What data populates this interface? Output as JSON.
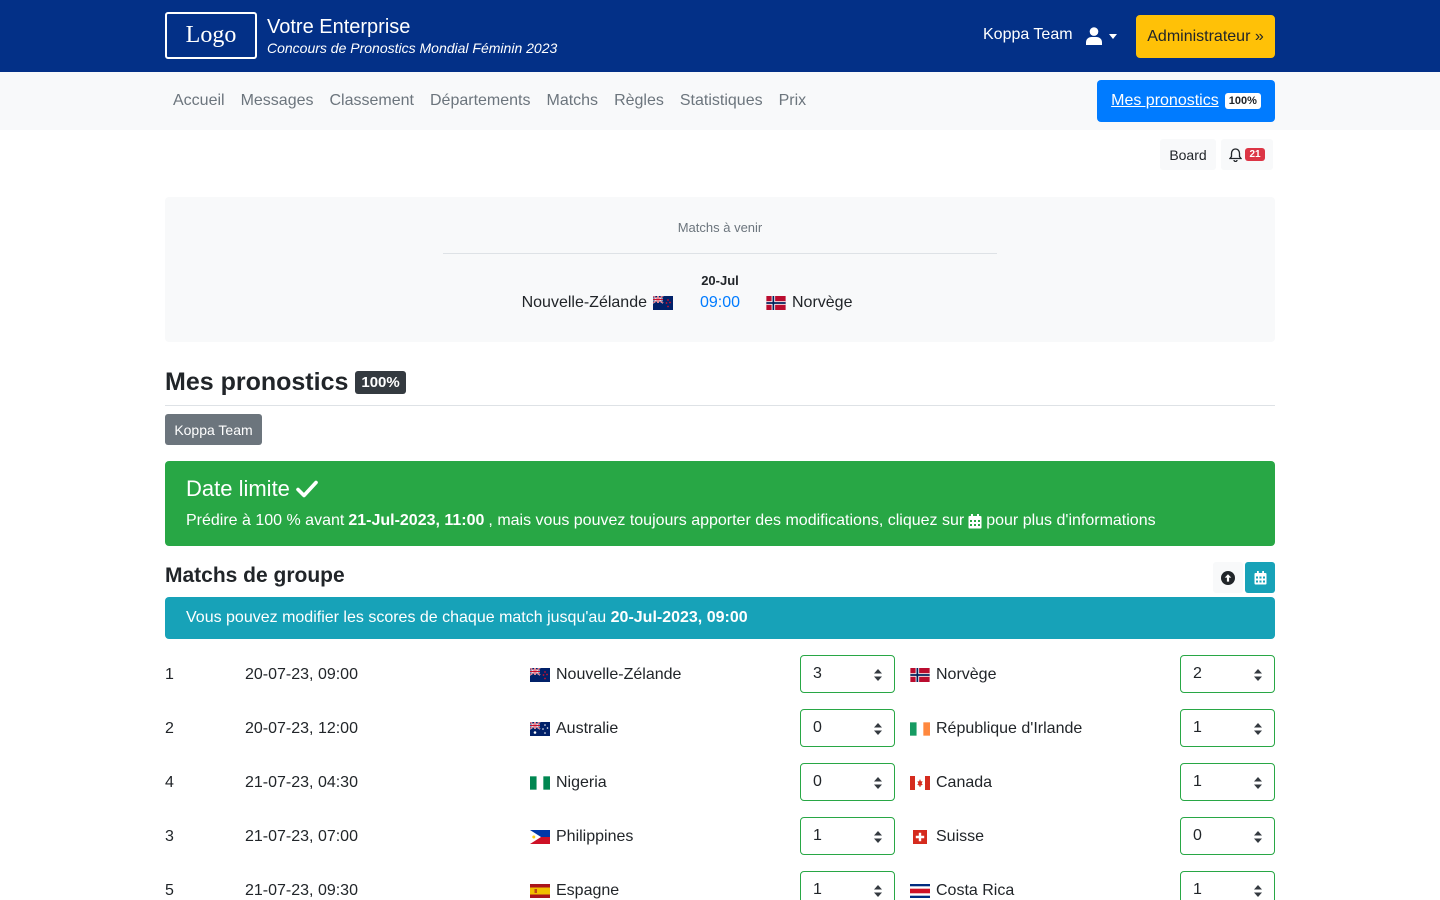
{
  "header": {
    "logo": "Logo",
    "brand_title": "Votre Enterprise",
    "brand_subtitle": "Concours de Pronostics Mondial Féminin 2023",
    "user_name": "Koppa Team",
    "admin_label": "Administrateur »",
    "icons": {
      "user": "user-icon",
      "dropdown": "caret-down-icon"
    }
  },
  "nav": {
    "items": [
      "Accueil",
      "Messages",
      "Classement",
      "Départements",
      "Matchs",
      "Règles",
      "Statistiques",
      "Prix"
    ],
    "cta_label": "Mes pronostics",
    "cta_badge": "100%"
  },
  "toolbar": {
    "board_label": "Board",
    "notif_count": "21",
    "icons": {
      "notifications": "bell-icon"
    }
  },
  "upcoming": {
    "title": "Matchs à venir",
    "date": "20-Jul",
    "home": "Nouvelle-Zélande",
    "time": "09:00",
    "away": "Norvège"
  },
  "predictions": {
    "title": "Mes pronostics",
    "badge": "100%",
    "team_button": "Koppa Team"
  },
  "deadline": {
    "title": "Date limite",
    "text_before": "Prédire à 100 % avant",
    "deadline_date": "21-Jul-2023, 11:00",
    "text_after": ", mais vous pouvez toujours apporter des modifications, cliquez sur",
    "text_end": "pour plus d'informations",
    "icons": {
      "check": "check-icon",
      "calendar": "calendar-icon"
    }
  },
  "group": {
    "title": "Matchs de groupe",
    "info_text": "Vous pouvez modifier les scores de chaque match jusqu'au",
    "info_date": "20-Jul-2023, 09:00",
    "icons": {
      "scroll_top": "arrow-up-circle-icon",
      "calendar": "calendar-icon"
    },
    "matches": [
      {
        "num": "1",
        "datetime": "20-07-23, 09:00",
        "home": "Nouvelle-Zélande",
        "home_score": "3",
        "away": "Norvège",
        "away_score": "2"
      },
      {
        "num": "2",
        "datetime": "20-07-23, 12:00",
        "home": "Australie",
        "home_score": "0",
        "away": "République d'Irlande",
        "away_score": "1"
      },
      {
        "num": "4",
        "datetime": "21-07-23, 04:30",
        "home": "Nigeria",
        "home_score": "0",
        "away": "Canada",
        "away_score": "1"
      },
      {
        "num": "3",
        "datetime": "21-07-23, 07:00",
        "home": "Philippines",
        "home_score": "1",
        "away": "Suisse",
        "away_score": "0"
      },
      {
        "num": "5",
        "datetime": "21-07-23, 09:30",
        "home": "Espagne",
        "home_score": "1",
        "away": "Costa Rica",
        "away_score": "1"
      }
    ]
  },
  "colors": {
    "header_bg": "#033087",
    "admin_button": "#ffc107",
    "primary": "#007bff",
    "success": "#28a745",
    "info": "#17a2b8",
    "danger": "#dc3545"
  }
}
